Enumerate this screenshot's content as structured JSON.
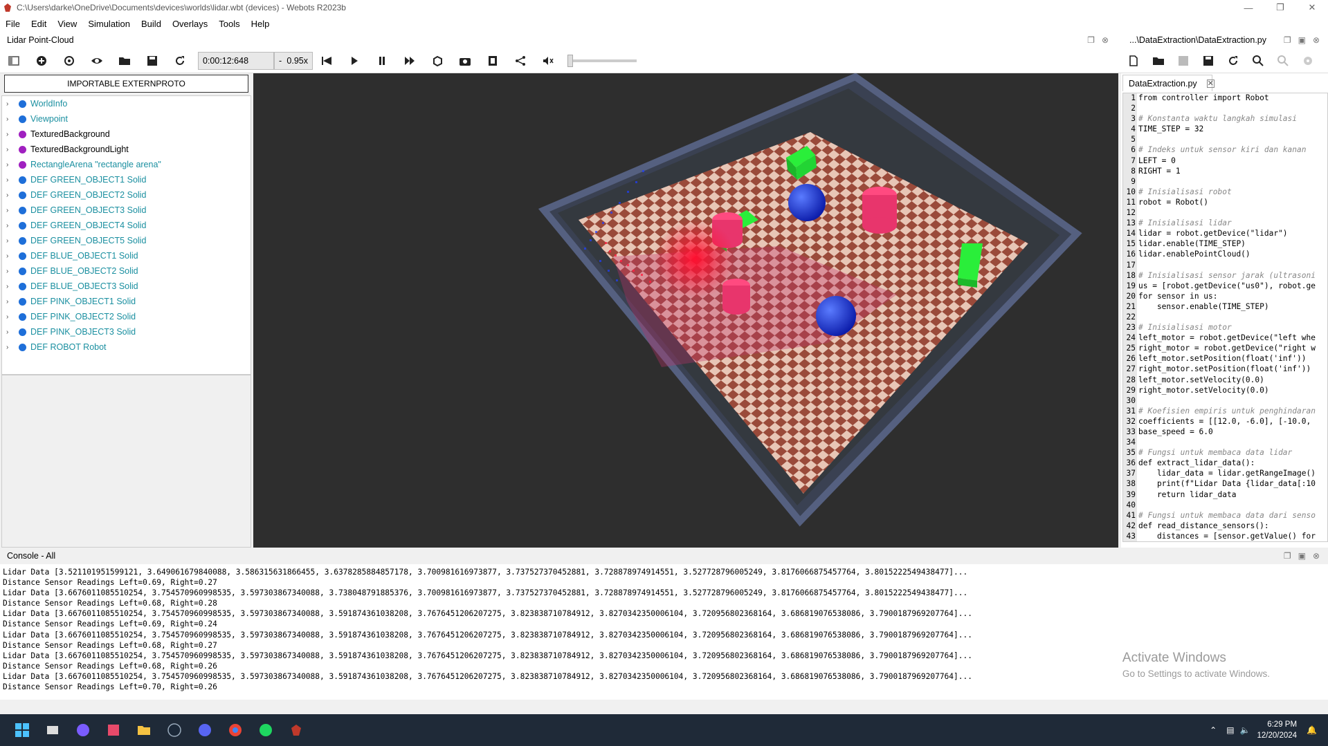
{
  "window": {
    "title": "C:\\Users\\darke\\OneDrive\\Documents\\devices\\worlds\\lidar.wbt (devices) - Webots R2023b"
  },
  "menu": [
    "File",
    "Edit",
    "View",
    "Simulation",
    "Build",
    "Overlays",
    "Tools",
    "Help"
  ],
  "panels": {
    "left_title": "Lidar Point-Cloud",
    "right_title": "...\\DataExtraction\\DataExtraction.py"
  },
  "toolbar": {
    "time": "0:00:12:648",
    "speed_sep": "-",
    "speed": "0.95x"
  },
  "scene_tree": {
    "proto_button": "IMPORTABLE EXTERNPROTO",
    "items": [
      {
        "label": "WorldInfo",
        "color": "#1e6fd9",
        "proto": false
      },
      {
        "label": "Viewpoint",
        "color": "#1e6fd9",
        "proto": false
      },
      {
        "label": "TexturedBackground",
        "color": "#a020c0",
        "proto": true
      },
      {
        "label": "TexturedBackgroundLight",
        "color": "#a020c0",
        "proto": true
      },
      {
        "label": "RectangleArena \"rectangle arena\"",
        "color": "#a020c0",
        "proto": false
      },
      {
        "label": "DEF GREEN_OBJECT1 Solid",
        "color": "#1e6fd9",
        "proto": false
      },
      {
        "label": "DEF GREEN_OBJECT2 Solid",
        "color": "#1e6fd9",
        "proto": false
      },
      {
        "label": "DEF GREEN_OBJECT3 Solid",
        "color": "#1e6fd9",
        "proto": false
      },
      {
        "label": "DEF GREEN_OBJECT4 Solid",
        "color": "#1e6fd9",
        "proto": false
      },
      {
        "label": "DEF GREEN_OBJECT5 Solid",
        "color": "#1e6fd9",
        "proto": false
      },
      {
        "label": "DEF BLUE_OBJECT1 Solid",
        "color": "#1e6fd9",
        "proto": false
      },
      {
        "label": "DEF BLUE_OBJECT2 Solid",
        "color": "#1e6fd9",
        "proto": false
      },
      {
        "label": "DEF BLUE_OBJECT3 Solid",
        "color": "#1e6fd9",
        "proto": false
      },
      {
        "label": "DEF PINK_OBJECT1 Solid",
        "color": "#1e6fd9",
        "proto": false
      },
      {
        "label": "DEF PINK_OBJECT2 Solid",
        "color": "#1e6fd9",
        "proto": false
      },
      {
        "label": "DEF PINK_OBJECT3 Solid",
        "color": "#1e6fd9",
        "proto": false
      },
      {
        "label": "DEF ROBOT Robot",
        "color": "#1e6fd9",
        "proto": false
      }
    ]
  },
  "editor": {
    "tab": "DataExtraction.py",
    "lines": [
      {
        "n": "1",
        "t": "from controller import Robot"
      },
      {
        "n": "2",
        "t": ""
      },
      {
        "n": "3",
        "t": "# Konstanta waktu langkah simulasi"
      },
      {
        "n": "4",
        "t": "TIME_STEP = 32"
      },
      {
        "n": "5",
        "t": ""
      },
      {
        "n": "6",
        "t": "# Indeks untuk sensor kiri dan kanan"
      },
      {
        "n": "7",
        "t": "LEFT = 0"
      },
      {
        "n": "8",
        "t": "RIGHT = 1"
      },
      {
        "n": "9",
        "t": ""
      },
      {
        "n": "10",
        "t": "# Inisialisasi robot"
      },
      {
        "n": "11",
        "t": "robot = Robot()"
      },
      {
        "n": "12",
        "t": ""
      },
      {
        "n": "13",
        "t": "# Inisialisasi lidar"
      },
      {
        "n": "14",
        "t": "lidar = robot.getDevice(\"lidar\")"
      },
      {
        "n": "15",
        "t": "lidar.enable(TIME_STEP)"
      },
      {
        "n": "16",
        "t": "lidar.enablePointCloud()"
      },
      {
        "n": "17",
        "t": ""
      },
      {
        "n": "18",
        "t": "# Inisialisasi sensor jarak (ultrasoni"
      },
      {
        "n": "19",
        "t": "us = [robot.getDevice(\"us0\"), robot.ge"
      },
      {
        "n": "20",
        "t": "for sensor in us:"
      },
      {
        "n": "21",
        "t": "    sensor.enable(TIME_STEP)"
      },
      {
        "n": "22",
        "t": ""
      },
      {
        "n": "23",
        "t": "# Inisialisasi motor"
      },
      {
        "n": "24",
        "t": "left_motor = robot.getDevice(\"left whe"
      },
      {
        "n": "25",
        "t": "right_motor = robot.getDevice(\"right w"
      },
      {
        "n": "26",
        "t": "left_motor.setPosition(float('inf'))"
      },
      {
        "n": "27",
        "t": "right_motor.setPosition(float('inf'))"
      },
      {
        "n": "28",
        "t": "left_motor.setVelocity(0.0)"
      },
      {
        "n": "29",
        "t": "right_motor.setVelocity(0.0)"
      },
      {
        "n": "30",
        "t": ""
      },
      {
        "n": "31",
        "t": "# Koefisien empiris untuk penghindaran"
      },
      {
        "n": "32",
        "t": "coefficients = [[12.0, -6.0], [-10.0,"
      },
      {
        "n": "33",
        "t": "base_speed = 6.0"
      },
      {
        "n": "34",
        "t": ""
      },
      {
        "n": "35",
        "t": "# Fungsi untuk membaca data lidar"
      },
      {
        "n": "36",
        "t": "def extract_lidar_data():"
      },
      {
        "n": "37",
        "t": "    lidar_data = lidar.getRangeImage()"
      },
      {
        "n": "38",
        "t": "    print(f\"Lidar Data {lidar_data[:10"
      },
      {
        "n": "39",
        "t": "    return lidar_data"
      },
      {
        "n": "40",
        "t": ""
      },
      {
        "n": "41",
        "t": "# Fungsi untuk membaca data dari senso"
      },
      {
        "n": "42",
        "t": "def read_distance_sensors():"
      },
      {
        "n": "43",
        "t": "    distances = [sensor.getValue() for"
      }
    ]
  },
  "console": {
    "title": "Console - All",
    "lines": [
      "Lidar Data [3.521101951599121, 3.649061679840088, 3.586315631866455, 3.6378285884857178, 3.700981616973877, 3.737527370452881, 3.728878974914551, 3.527728796005249, 3.8176066875457764, 3.8015222549438477]...",
      "Distance Sensor Readings Left=0.69, Right=0.27",
      "Lidar Data [3.6676011085510254, 3.754570960998535, 3.597303867340088, 3.738048791885376, 3.700981616973877, 3.737527370452881, 3.728878974914551, 3.527728796005249, 3.8176066875457764, 3.8015222549438477]...",
      "Distance Sensor Readings Left=0.68, Right=0.28",
      "Lidar Data [3.6676011085510254, 3.754570960998535, 3.597303867340088, 3.591874361038208, 3.7676451206207275, 3.823838710784912, 3.8270342350006104, 3.720956802368164, 3.686819076538086, 3.7900187969207764]...",
      "Distance Sensor Readings Left=0.69, Right=0.24",
      "Lidar Data [3.6676011085510254, 3.754570960998535, 3.597303867340088, 3.591874361038208, 3.7676451206207275, 3.823838710784912, 3.8270342350006104, 3.720956802368164, 3.686819076538086, 3.7900187969207764]...",
      "Distance Sensor Readings Left=0.68, Right=0.27",
      "Lidar Data [3.6676011085510254, 3.754570960998535, 3.597303867340088, 3.591874361038208, 3.7676451206207275, 3.823838710784912, 3.8270342350006104, 3.720956802368164, 3.686819076538086, 3.7900187969207764]...",
      "Distance Sensor Readings Left=0.68, Right=0.26",
      "Lidar Data [3.6676011085510254, 3.754570960998535, 3.597303867340088, 3.591874361038208, 3.7676451206207275, 3.823838710784912, 3.8270342350006104, 3.720956802368164, 3.686819076538086, 3.7900187969207764]...",
      "Distance Sensor Readings Left=0.70, Right=0.26"
    ]
  },
  "watermark": {
    "title": "Activate Windows",
    "subtitle": "Go to Settings to activate Windows."
  },
  "taskbar": {
    "time": "6:29 PM",
    "date": "12/20/2024"
  }
}
